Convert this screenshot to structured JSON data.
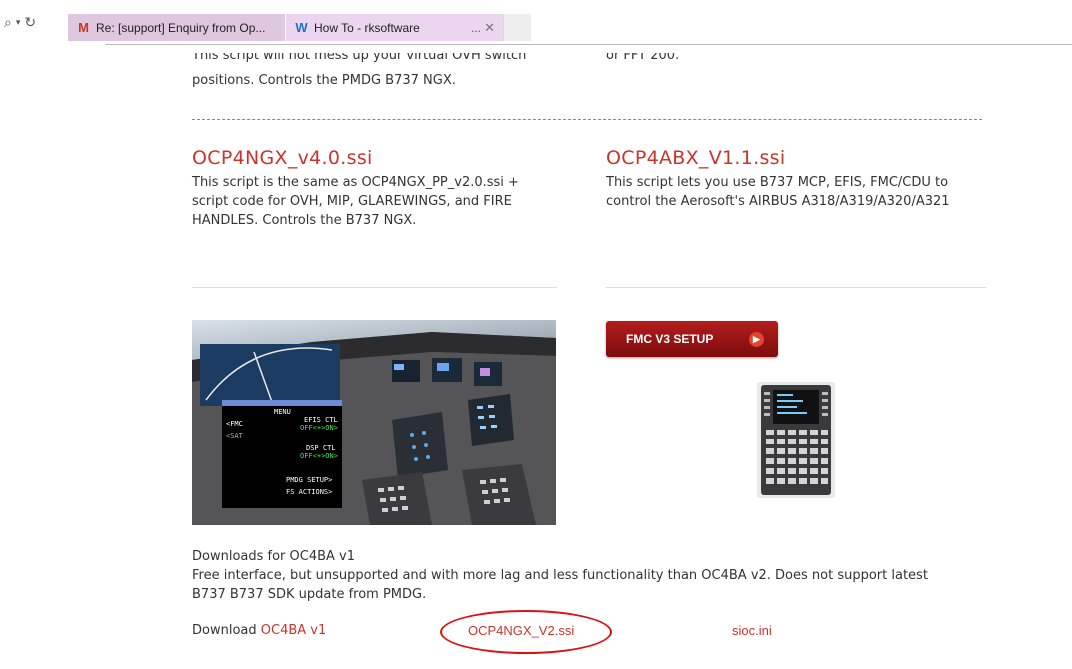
{
  "browser": {
    "tabs": [
      {
        "label": "Re: [support] Enquiry from Op...",
        "icon": "gmail-icon"
      },
      {
        "label": "How To - rksoftware",
        "icon": "w-icon",
        "ellipsis": "..."
      }
    ]
  },
  "page": {
    "intro_left_cut": "This script will not mess up your virtual OVH switch",
    "intro_left_line2": "positions. Controls the PMDG B737 NGX.",
    "intro_right_cut": "or FFT 200.",
    "left_card": {
      "title": "OCP4NGX_v4.0.ssi",
      "desc_lines": [
        "This script  is the same as OCP4NGX_PP_v2.0.ssi +",
        "script code for OVH, MIP, GLAREWINGS, and FIRE",
        "HANDLES. Controls the B737 NGX."
      ]
    },
    "right_card": {
      "title": "OCP4ABX_V1.1.ssi",
      "desc_lines": [
        "This script lets you use B737 MCP, EFIS, FMC/CDU to",
        "control the Aerosoft's AIRBUS A318/A319/A320/A321"
      ]
    },
    "fmc_button": "FMC V3 SETUP",
    "cockpit_overlay": {
      "menu": "MENU",
      "fmc": "<FMC",
      "sat": "<SAT",
      "efis_ctl": "EFIS CTL",
      "efis_state": "OFF<+>ON>",
      "dsp_ctl": "DSP CTL",
      "dsp_state": "OFF<+>ON>",
      "pmdg_setup": "PMDG SETUP>",
      "fs_actions": "FS ACTIONS>"
    },
    "downloads": {
      "heading": "Downloads for OC4BA v1",
      "desc_line1": "Free interface, but unsupported and with more lag and less functionality than OC4BA v2. Does not support latest",
      "desc_line2": "B737 B737 SDK update from PMDG.",
      "download_label": "Download",
      "link1": "OC4BA v1",
      "link2": "OCP4NGX_V2.ssi",
      "link3": "sioc.ini"
    }
  }
}
